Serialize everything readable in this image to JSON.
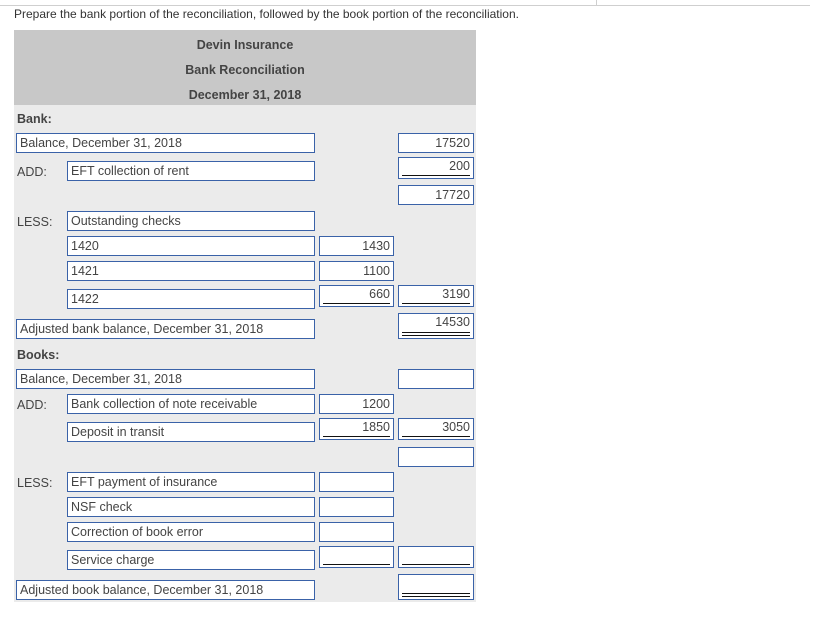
{
  "instruction": "Prepare the bank portion of the reconciliation, followed by the book portion of the reconciliation.",
  "header": {
    "company": "Devin Insurance",
    "title": "Bank Reconciliation",
    "date": "December 31, 2018"
  },
  "bank": {
    "section_label": "Bank:",
    "balance": {
      "label": "Balance, December 31, 2018",
      "amount": "17520"
    },
    "add": {
      "label": "ADD:",
      "items": [
        {
          "description": "EFT collection of rent",
          "total": "200"
        }
      ],
      "subtotal": "17720"
    },
    "less": {
      "label": "LESS:",
      "heading": "Outstanding checks",
      "items": [
        {
          "description": "1420",
          "amount": "1430"
        },
        {
          "description": "1421",
          "amount": "1100"
        },
        {
          "description": "1422",
          "amount": "660"
        }
      ],
      "total": "3190"
    },
    "adjusted": {
      "label": "Adjusted bank balance, December 31, 2018",
      "amount": "14530"
    }
  },
  "books": {
    "section_label": "Books:",
    "balance": {
      "label": "Balance, December 31, 2018",
      "amount": ""
    },
    "add": {
      "label": "ADD:",
      "items": [
        {
          "description": "Bank collection of note receivable",
          "amount": "1200"
        },
        {
          "description": "Deposit in transit",
          "amount": "1850"
        }
      ],
      "total": "3050",
      "subtotal": ""
    },
    "less": {
      "label": "LESS:",
      "items": [
        {
          "description": "EFT payment of insurance",
          "amount": ""
        },
        {
          "description": "NSF check",
          "amount": ""
        },
        {
          "description": "Correction of book error",
          "amount": ""
        },
        {
          "description": "Service charge",
          "amount": ""
        }
      ],
      "total": ""
    },
    "adjusted": {
      "label": "Adjusted book balance, December 31, 2018",
      "amount": ""
    }
  }
}
